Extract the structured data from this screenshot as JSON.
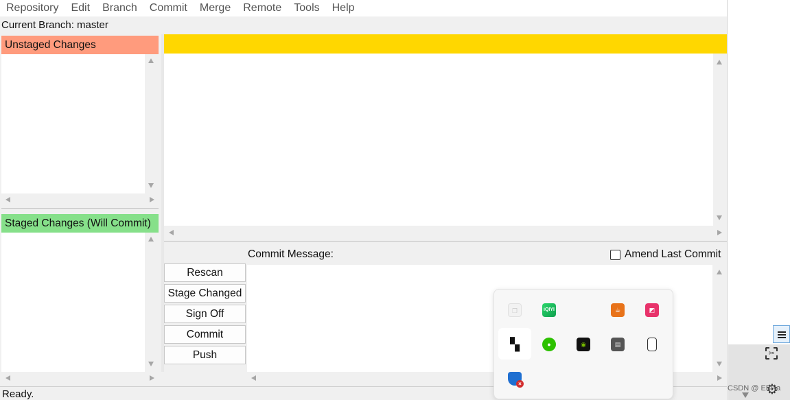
{
  "menubar": {
    "items": [
      "Repository",
      "Edit",
      "Branch",
      "Commit",
      "Merge",
      "Remote",
      "Tools",
      "Help"
    ]
  },
  "branch_label": "Current Branch: master",
  "unstaged": {
    "title": "Unstaged Changes",
    "color": "#ff9b7d"
  },
  "staged": {
    "title": "Staged Changes (Will Commit)",
    "color": "#86e08a"
  },
  "diff": {
    "header_color": "#ffd700"
  },
  "commit": {
    "message_label": "Commit Message:",
    "amend_label": "Amend Last Commit",
    "amend_checked": false,
    "buttons": [
      "Rescan",
      "Stage Changed",
      "Sign Off",
      "Commit",
      "Push"
    ]
  },
  "status": "Ready.",
  "tray": {
    "icons": [
      "copy-icon",
      "iqiyi-icon",
      "java-icon",
      "pink-app-icon",
      "black-app-icon",
      "wechat-icon",
      "nvidia-icon",
      "archive-icon",
      "usb-icon",
      "defender-icon"
    ],
    "iqiyi_text": "iQIYI"
  },
  "watermark": "CSDN @ EBRa"
}
